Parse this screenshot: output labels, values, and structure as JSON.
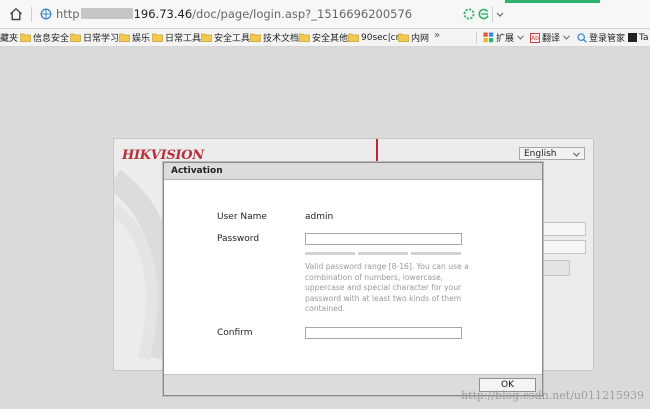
{
  "browser": {
    "url_prefix": "http",
    "url_host": "196.73.46",
    "url_path": "/doc/page/login.asp?_1516696200576"
  },
  "bookmarks": {
    "items": [
      {
        "label": "藏夹",
        "folder": false
      },
      {
        "label": "信息安全",
        "folder": true
      },
      {
        "label": "日常学习",
        "folder": true
      },
      {
        "label": "娱乐",
        "folder": true
      },
      {
        "label": "日常工具",
        "folder": true
      },
      {
        "label": "安全工具",
        "folder": true
      },
      {
        "label": "技术文档",
        "folder": true
      },
      {
        "label": "安全其他",
        "folder": true
      },
      {
        "label": "90sec|cn",
        "folder": true
      },
      {
        "label": "内网",
        "folder": true
      }
    ],
    "more": "»",
    "tools": {
      "extensions": "扩展",
      "translate": "翻译",
      "login_manager": "登录管家",
      "tab_partial": "Ta",
      "translate_badge": "Ab"
    }
  },
  "login": {
    "logo": "HIKVISION",
    "language": "English"
  },
  "dialog": {
    "title": "Activation",
    "username_label": "User Name",
    "username_value": "admin",
    "password_label": "Password",
    "password_value": "",
    "hint": "Valid password range [8-16]. You can use a combination of numbers, lowercase, uppercase and special character for your password with at least two kinds of them contained.",
    "confirm_label": "Confirm",
    "confirm_value": "",
    "ok_label": "OK"
  },
  "watermark": "http://blog.csdn.net/u011215939",
  "colors": {
    "brand_red": "#b8303a",
    "accent_green": "#2fb26b"
  }
}
